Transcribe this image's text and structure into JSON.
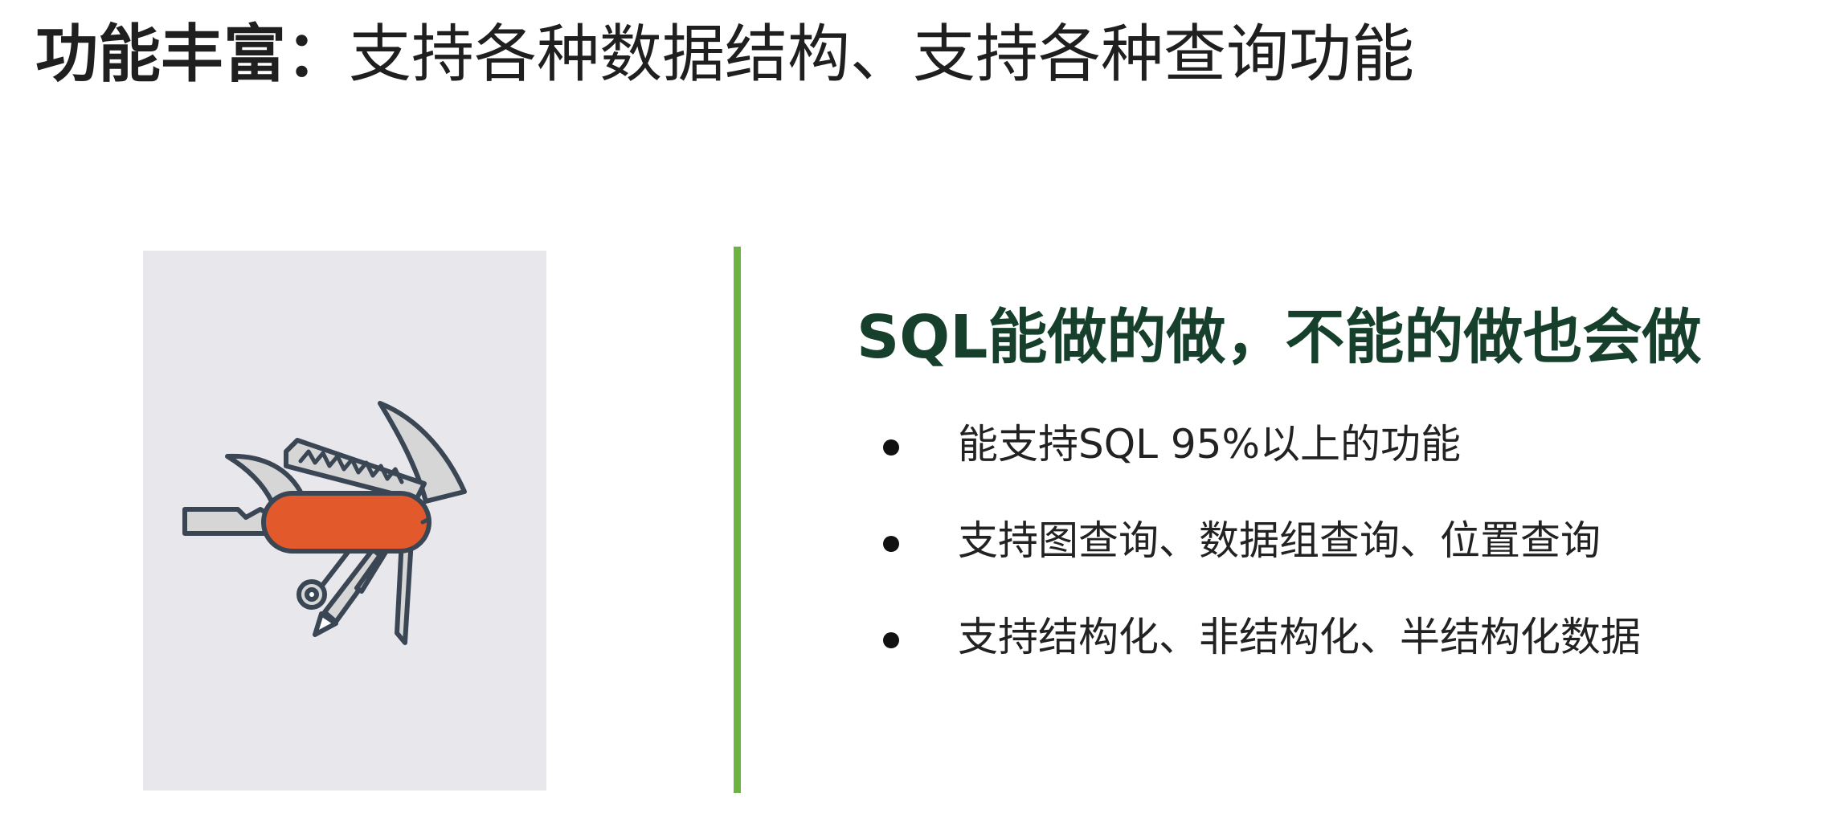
{
  "slide": {
    "title_lead": "功能丰富：",
    "title_rest": "支持各种数据结构、支持各种查询功能",
    "headline": "SQL能做的做，不能的做也会做",
    "bullets": [
      "能支持SQL 95%以上的功能",
      "支持图查询、数据组查询、位置查询",
      "支持结构化、非结构化、半结构化数据"
    ],
    "illustration_icon": "swiss-army-knife-icon",
    "colors": {
      "divider": "#6cb43f",
      "headline": "#17402c",
      "knife_handle": "#e25a2c",
      "tool_outline": "#3b4654",
      "tool_fill": "#d6d6d6",
      "illustration_bg": "#e8e8ec"
    }
  }
}
